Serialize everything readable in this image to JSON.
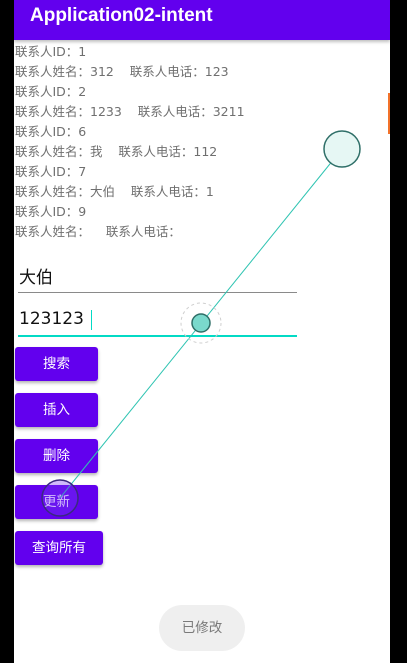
{
  "app_title": "Application02-intent",
  "records": [
    "联系人ID：1",
    "联系人姓名：312    联系人电话：123",
    "联系人ID：2",
    "联系人姓名：1233    联系人电话：3211",
    "联系人ID：6",
    "联系人姓名：我    联系人电话：112",
    "联系人ID：7",
    "联系人姓名：大伯    联系人电话：1",
    "联系人ID：9",
    "联系人姓名：    联系人电话："
  ],
  "inputs": {
    "name_value": "大伯",
    "phone_value": "123123"
  },
  "buttons": {
    "search": "搜索",
    "insert": "插入",
    "delete": "删除",
    "update": "更新",
    "query_all": "查询所有"
  },
  "toast": "已修改",
  "colors": {
    "primary": "#6200ee",
    "accent": "#03dac5"
  }
}
